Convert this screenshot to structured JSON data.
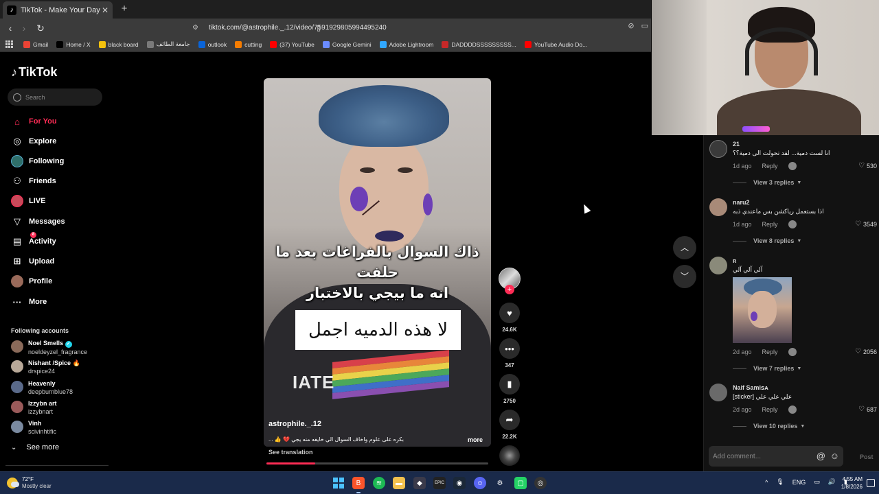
{
  "browser": {
    "tab_title": "TikTok - Make Your Day",
    "tab_close": "✕",
    "new_tab": "+",
    "url": "tiktok.com/@astrophile._.12/video/7591929805994495240",
    "bookmarks": [
      {
        "label": "Gmail",
        "color": "#ea4335"
      },
      {
        "label": "Home / X",
        "color": "#000000"
      },
      {
        "label": "black board",
        "color": "#f4c20d"
      },
      {
        "label": "جامعة الطائف",
        "color": "#7a7a7a"
      },
      {
        "label": "outlook",
        "color": "#0a64d8"
      },
      {
        "label": "cutting",
        "color": "#f57c00"
      },
      {
        "label": "(37) YouTube",
        "color": "#ff0000"
      },
      {
        "label": "Google Gemini",
        "color": "#6b8cff"
      },
      {
        "label": "Adobe Lightroom",
        "color": "#31a8ff"
      },
      {
        "label": "DADDDDSSSSSSSSS...",
        "color": "#c62828"
      },
      {
        "label": "YouTube Audio Do...",
        "color": "#ff0000"
      }
    ]
  },
  "sidebar": {
    "logo": "TikTok",
    "search_placeholder": "Search",
    "nav": [
      {
        "label": "For You",
        "icon": "home-icon",
        "active": true
      },
      {
        "label": "Explore",
        "icon": "compass-icon"
      },
      {
        "label": "Following",
        "icon": "following-avatar-icon"
      },
      {
        "label": "Friends",
        "icon": "friends-icon"
      },
      {
        "label": "LIVE",
        "icon": "live-avatar-icon"
      },
      {
        "label": "Messages",
        "icon": "messages-icon"
      },
      {
        "label": "Activity",
        "icon": "activity-icon",
        "badge": "8"
      },
      {
        "label": "Upload",
        "icon": "upload-icon"
      },
      {
        "label": "Profile",
        "icon": "profile-avatar-icon"
      },
      {
        "label": "More",
        "icon": "more-icon"
      }
    ],
    "following_heading": "Following accounts",
    "accounts": [
      {
        "name": "Noel Smells",
        "verified": "✔",
        "handle": "noeldeyzel_fragrance",
        "color": "#8a6a5a"
      },
      {
        "name": "Nishant /Spice",
        "emoji": "🔥",
        "handle": "drspice24",
        "color": "#b8a898"
      },
      {
        "name": "Heavenly",
        "handle": "deepburnblue78",
        "color": "#5a6a8a"
      },
      {
        "name": "Izzybn art",
        "handle": "izzybnart",
        "color": "#9a5a5a"
      },
      {
        "name": "Vinh",
        "handle": "scivinhtific",
        "color": "#7a8aa0"
      }
    ],
    "see_more": "See more"
  },
  "video": {
    "overlay_text_line1": "ذاك السوال بالفراغات بعد ما حلفت",
    "overlay_text_line2": "انه ما بيجي بالاختبار",
    "caption_box": "لا هذه الدميه اجمل",
    "shirt_text": "IATE",
    "author": "astrophile._.12",
    "description": "بكره على علوم واخاف السوال الي خايفه منه يجي 💔 👍 ...",
    "more": "more",
    "see_translation": "See translation",
    "progress": 0.22,
    "rainbow_colors": [
      "#d8404a",
      "#e8863a",
      "#e9d24a",
      "#4ca85a",
      "#3f6fc8",
      "#8a4fb0"
    ]
  },
  "actions": {
    "follow": "+",
    "likes": "24.6K",
    "comments": "347",
    "saves": "2750",
    "shares": "22.2K"
  },
  "comments": [
    {
      "user": "21",
      "text": "انا لست دمية... لقد تحولت الى دمية؟؟",
      "time": "1d ago",
      "reply": "Reply",
      "likes": "530",
      "view_replies": "View 3 replies",
      "avatar": "#3a3a3a"
    },
    {
      "user": "naru2",
      "text": "اذا بستعمل رياكشن بس ماعندي ذبه",
      "time": "1d ago",
      "reply": "Reply",
      "likes": "3549",
      "view_replies": "View 8 replies",
      "avatar": "#a88a78"
    },
    {
      "user": "ʀ",
      "text": "آلي آلي آلي",
      "time": "2d ago",
      "reply": "Reply",
      "likes": "2056",
      "view_replies": "View 7 replies",
      "avatar": "#8a8a7a"
    },
    {
      "user": "Naif Samiꜱᴀ",
      "text": "علي علي علي [sticker]",
      "time": "2d ago",
      "reply": "Reply",
      "likes": "687",
      "view_replies": "View 10 replies",
      "avatar": "#6a6a6a"
    }
  ],
  "comment_input": {
    "placeholder": "Add comment...",
    "at": "@",
    "emoji": "☺",
    "post": "Post"
  },
  "taskbar": {
    "temp": "72°F",
    "condition": "Mostly clear",
    "language": "ENG",
    "time": "4:55 AM",
    "date": "1/8/2026"
  }
}
